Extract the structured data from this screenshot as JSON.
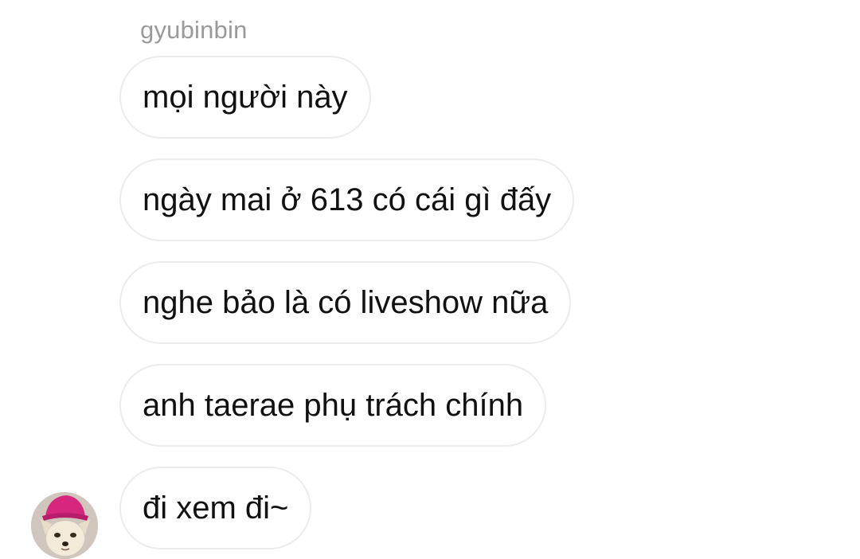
{
  "chat": {
    "sender_name": "gyubinbin",
    "messages": [
      {
        "text": "mọi người này"
      },
      {
        "text": "ngày mai ở 613 có cái gì đấy"
      },
      {
        "text": "nghe bảo là có liveshow nữa"
      },
      {
        "text": "anh taerae phụ trách chính"
      },
      {
        "text": "đi xem đi~"
      }
    ],
    "avatar": {
      "icon": "avatar-dog-with-pink-hat"
    }
  },
  "colors": {
    "background": "#ffffff",
    "bubble_border": "#ececec",
    "sender_text": "#9a9a9a",
    "message_text": "#111111"
  }
}
